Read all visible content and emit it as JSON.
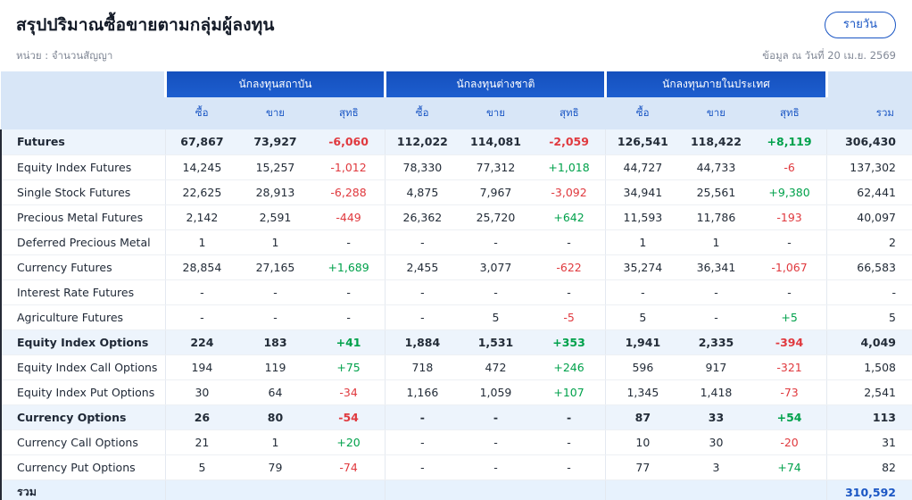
{
  "header": {
    "title": "สรุปปริมาณซื้อขายตามกลุ่มผู้ลงทุน",
    "unit": "หน่วย : จำนวนสัญญา",
    "as_of": "ข้อมูล ณ วันที่ 20 เม.ย. 2569",
    "period_button": "รายวัน"
  },
  "colors": {
    "accent": "#1a56c4",
    "positive": "#00a14b",
    "negative": "#e0393e"
  },
  "table": {
    "column_groups": [
      {
        "label": "นักลงทุนสถาบัน"
      },
      {
        "label": "นักลงทุนต่างชาติ"
      },
      {
        "label": "นักลงทุนภายในประเทศ"
      }
    ],
    "sub_columns": [
      "ซื้อ",
      "ขาย",
      "สุทธิ"
    ],
    "total_column": "รวม",
    "rows": [
      {
        "label": "Futures",
        "emphasis": true,
        "cells": [
          "67,867",
          "73,927",
          "-6,060",
          "112,022",
          "114,081",
          "-2,059",
          "126,541",
          "118,422",
          "+8,119"
        ],
        "total": "306,430"
      },
      {
        "label": "Equity Index Futures",
        "cells": [
          "14,245",
          "15,257",
          "-1,012",
          "78,330",
          "77,312",
          "+1,018",
          "44,727",
          "44,733",
          "-6"
        ],
        "total": "137,302"
      },
      {
        "label": "Single Stock Futures",
        "cells": [
          "22,625",
          "28,913",
          "-6,288",
          "4,875",
          "7,967",
          "-3,092",
          "34,941",
          "25,561",
          "+9,380"
        ],
        "total": "62,441"
      },
      {
        "label": "Precious Metal Futures",
        "cells": [
          "2,142",
          "2,591",
          "-449",
          "26,362",
          "25,720",
          "+642",
          "11,593",
          "11,786",
          "-193"
        ],
        "total": "40,097"
      },
      {
        "label": "Deferred Precious Metal",
        "cells": [
          "1",
          "1",
          "-",
          "-",
          "-",
          "-",
          "1",
          "1",
          "-"
        ],
        "total": "2"
      },
      {
        "label": "Currency Futures",
        "cells": [
          "28,854",
          "27,165",
          "+1,689",
          "2,455",
          "3,077",
          "-622",
          "35,274",
          "36,341",
          "-1,067"
        ],
        "total": "66,583"
      },
      {
        "label": "Interest Rate Futures",
        "cells": [
          "-",
          "-",
          "-",
          "-",
          "-",
          "-",
          "-",
          "-",
          "-"
        ],
        "total": "-"
      },
      {
        "label": "Agriculture Futures",
        "cells": [
          "-",
          "-",
          "-",
          "-",
          "5",
          "-5",
          "5",
          "-",
          "+5"
        ],
        "total": "5"
      },
      {
        "label": "Equity Index Options",
        "emphasis": true,
        "cells": [
          "224",
          "183",
          "+41",
          "1,884",
          "1,531",
          "+353",
          "1,941",
          "2,335",
          "-394"
        ],
        "total": "4,049"
      },
      {
        "label": "Equity Index Call Options",
        "cells": [
          "194",
          "119",
          "+75",
          "718",
          "472",
          "+246",
          "596",
          "917",
          "-321"
        ],
        "total": "1,508"
      },
      {
        "label": "Equity Index Put Options",
        "cells": [
          "30",
          "64",
          "-34",
          "1,166",
          "1,059",
          "+107",
          "1,345",
          "1,418",
          "-73"
        ],
        "total": "2,541"
      },
      {
        "label": "Currency Options",
        "emphasis": true,
        "cells": [
          "26",
          "80",
          "-54",
          "-",
          "-",
          "-",
          "87",
          "33",
          "+54"
        ],
        "total": "113"
      },
      {
        "label": "Currency Call Options",
        "cells": [
          "21",
          "1",
          "+20",
          "-",
          "-",
          "-",
          "10",
          "30",
          "-20"
        ],
        "total": "31"
      },
      {
        "label": "Currency Put Options",
        "cells": [
          "5",
          "79",
          "-74",
          "-",
          "-",
          "-",
          "77",
          "3",
          "+74"
        ],
        "total": "82"
      },
      {
        "label": "รวม",
        "total_row": true,
        "cells": [
          "",
          "",
          "",
          "",
          "",
          "",
          "",
          "",
          ""
        ],
        "total": "310,592"
      }
    ]
  }
}
